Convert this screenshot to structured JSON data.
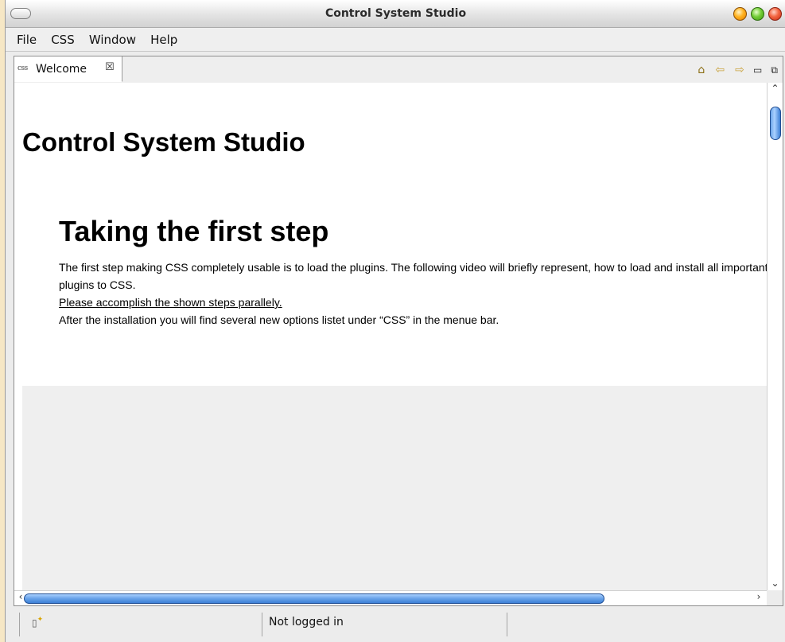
{
  "window": {
    "title": "Control System Studio"
  },
  "menu": {
    "items": [
      "File",
      "CSS",
      "Window",
      "Help"
    ]
  },
  "tab": {
    "icon_text": "css",
    "label": "Welcome",
    "close_glyph": "☒"
  },
  "toolbar": {
    "home_icon": "⌂",
    "back_icon": "⇦",
    "forward_icon": "⇨",
    "minimize_icon": "▭",
    "maximize_icon": "⧉"
  },
  "content": {
    "doc_title": "Control System Studio",
    "section_title": "Taking the first step",
    "paragraph_1": "The first step making CSS completely usable is to load the plugins. The following video will briefly represent, how to load and install all important plugins to CSS.",
    "link_text": "Please accomplish the shown steps parallely.",
    "paragraph_2": "After the installation you will find several new options listet under “CSS” in the menue bar."
  },
  "status": {
    "text": "Not logged in"
  }
}
